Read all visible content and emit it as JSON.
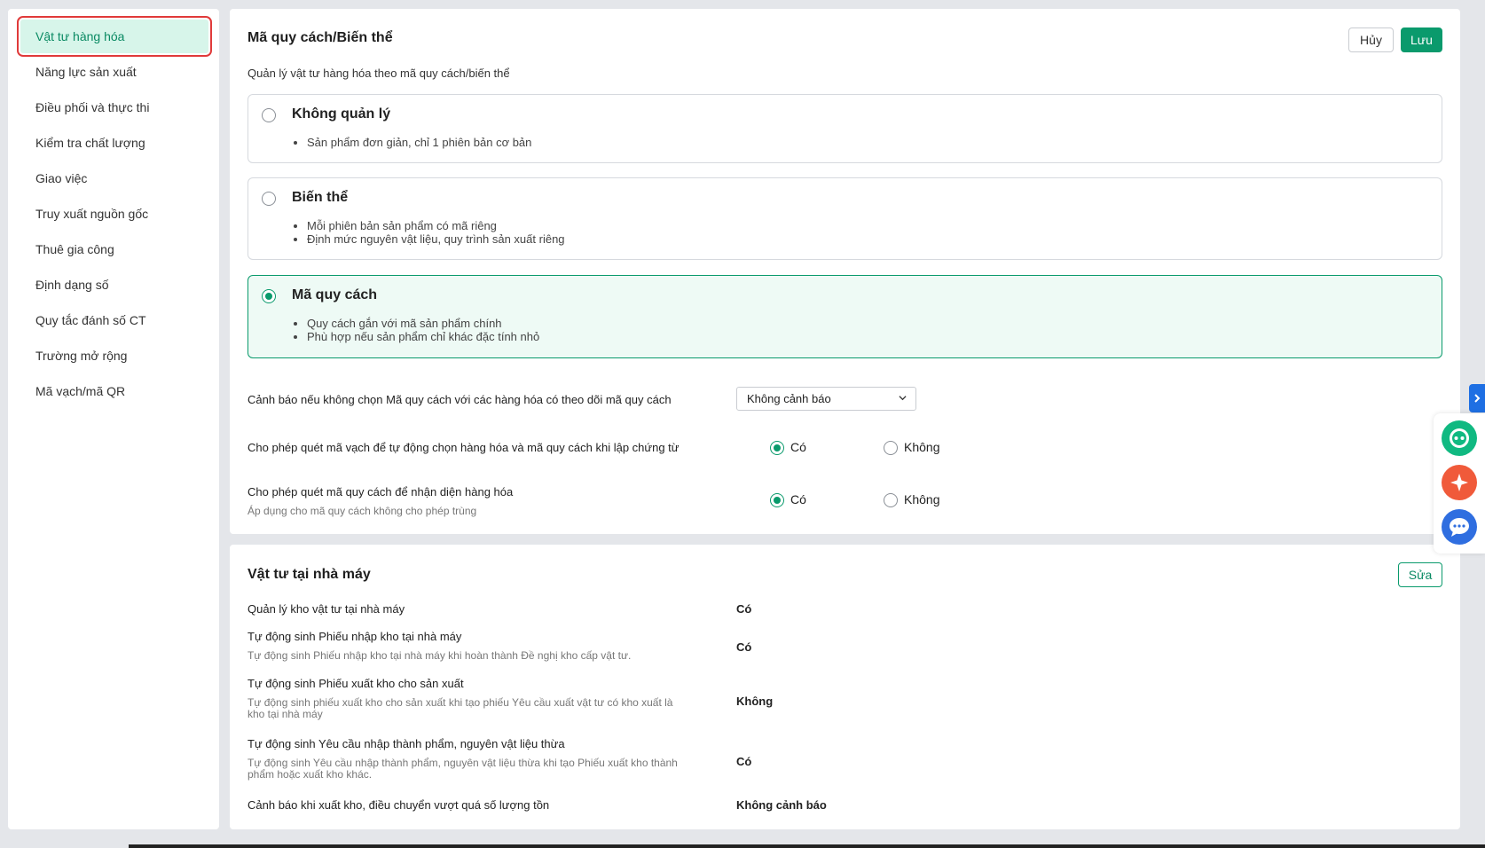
{
  "sidebar": {
    "items": [
      {
        "label": "Vật tư hàng hóa"
      },
      {
        "label": "Năng lực sản xuất"
      },
      {
        "label": "Điều phối và thực thi"
      },
      {
        "label": "Kiểm tra chất lượng"
      },
      {
        "label": "Giao việc"
      },
      {
        "label": "Truy xuất nguồn gốc"
      },
      {
        "label": "Thuê gia công"
      },
      {
        "label": "Định dạng số"
      },
      {
        "label": "Quy tắc đánh số CT"
      },
      {
        "label": "Trường mở rộng"
      },
      {
        "label": "Mã vạch/mã QR"
      }
    ]
  },
  "variant": {
    "title": "Mã quy cách/Biến thể",
    "cancel_label": "Hủy",
    "save_label": "Lưu",
    "subtitle": "Quản lý vật tư hàng hóa theo mã quy cách/biến thể",
    "options": [
      {
        "title": "Không quản lý",
        "bullets": [
          "Sản phẩm đơn giản, chỉ 1 phiên bản cơ bản"
        ]
      },
      {
        "title": "Biến thể",
        "bullets": [
          "Mỗi phiên bản sản phẩm có mã riêng",
          "Định mức nguyên vật liệu, quy trình sản xuất riêng"
        ]
      },
      {
        "title": "Mã quy cách",
        "bullets": [
          "Quy cách gắn với mã sản phẩm chính",
          "Phù hợp nếu sản phẩm chỉ khác đặc tính nhỏ"
        ]
      }
    ],
    "selected_option": "Mã quy cách",
    "warning_setting": {
      "label": "Cảnh báo nếu không chọn Mã quy cách với các hàng hóa có theo dõi mã quy cách",
      "value": "Không cảnh báo"
    },
    "scan_barcode": {
      "label": "Cho phép quét mã vạch để tự động chọn hàng hóa và mã quy cách khi lập chứng từ",
      "yes": "Có",
      "no": "Không",
      "selected": "Có"
    },
    "scan_spec": {
      "label": "Cho phép quét mã quy cách để nhận diện hàng hóa",
      "hint": "Áp dụng cho mã quy cách không cho phép trùng",
      "yes": "Có",
      "no": "Không",
      "selected": "Có"
    }
  },
  "factory": {
    "title": "Vật tư tại nhà máy",
    "edit_label": "Sửa",
    "rows": [
      {
        "label": "Quản lý kho vật tư tại nhà máy",
        "hint": "",
        "value": "Có"
      },
      {
        "label": "Tự động sinh Phiếu nhập kho tại nhà máy",
        "hint": "Tự động sinh Phiếu nhập kho tại nhà máy khi hoàn thành Đề nghị kho cấp vật tư.",
        "value": "Có"
      },
      {
        "label": "Tự động sinh Phiếu xuất kho cho sản xuất",
        "hint": "Tự động sinh phiếu xuất kho cho sản xuất khi tạo phiếu Yêu cầu xuất vật tư có kho xuất là kho tại nhà máy",
        "value": "Không"
      },
      {
        "label": "Tự động sinh Yêu cầu nhập thành phẩm, nguyên vật liệu thừa",
        "hint": "Tự động sinh Yêu cầu nhập thành phẩm, nguyên vật liệu thừa khi tạo Phiếu xuất kho thành phẩm hoặc xuất kho khác.",
        "value": "Có"
      },
      {
        "label": "Cảnh báo khi xuất kho, điều chuyển vượt quá số lượng tồn",
        "hint": "",
        "value": "Không cảnh báo"
      }
    ]
  },
  "colors": {
    "accent": "#0a9a6c",
    "selected_bg": "#eefaf5",
    "highlight_border": "#e03a3a"
  }
}
